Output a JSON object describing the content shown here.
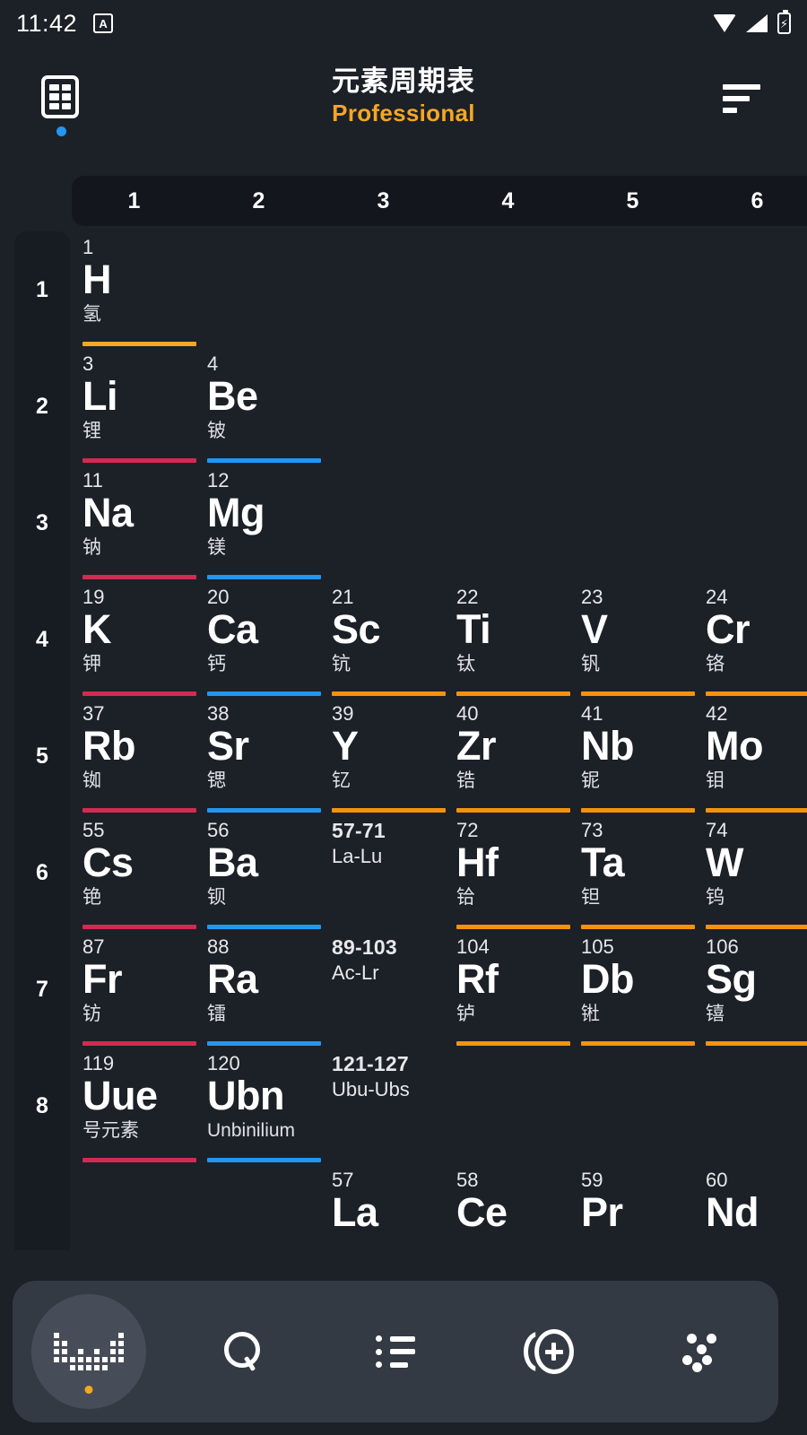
{
  "status_bar": {
    "time": "11:42",
    "badge_letter": "A",
    "icons": [
      "wifi-icon",
      "signal-icon",
      "battery-charging-icon"
    ]
  },
  "app_bar": {
    "logo_icon": "periodic-table-app-icon",
    "title": "元素周期表",
    "subtitle": "Professional",
    "menu_icon": "sort-filter-icon"
  },
  "table": {
    "group_headers": [
      "1",
      "2",
      "3",
      "4",
      "5",
      "6"
    ],
    "period_labels": [
      "1",
      "2",
      "3",
      "4",
      "5",
      "6",
      "7",
      "8"
    ],
    "colors": {
      "alkali_metal": "#d32a52",
      "alkaline_earth": "#2196f3",
      "transition_metal": "#f5920b",
      "nonmetal": "#f5a623",
      "background": "#1c2027",
      "sidebar": "#171b22",
      "header_strip": "#13171d"
    },
    "cells": [
      {
        "num": "1",
        "sym": "H",
        "name": "氢",
        "col": 1,
        "row": 1,
        "color": "#f5a623",
        "radioactive": false
      },
      {
        "num": "3",
        "sym": "Li",
        "name": "锂",
        "col": 1,
        "row": 2,
        "color": "#d32a52",
        "radioactive": false
      },
      {
        "num": "4",
        "sym": "Be",
        "name": "铍",
        "col": 2,
        "row": 2,
        "color": "#2196f3",
        "radioactive": false
      },
      {
        "num": "11",
        "sym": "Na",
        "name": "钠",
        "col": 1,
        "row": 3,
        "color": "#d32a52",
        "radioactive": false
      },
      {
        "num": "12",
        "sym": "Mg",
        "name": "镁",
        "col": 2,
        "row": 3,
        "color": "#2196f3",
        "radioactive": false
      },
      {
        "num": "19",
        "sym": "K",
        "name": "钾",
        "col": 1,
        "row": 4,
        "color": "#d32a52",
        "radioactive": false
      },
      {
        "num": "20",
        "sym": "Ca",
        "name": "钙",
        "col": 2,
        "row": 4,
        "color": "#2196f3",
        "radioactive": false
      },
      {
        "num": "21",
        "sym": "Sc",
        "name": "钪",
        "col": 3,
        "row": 4,
        "color": "#f5920b",
        "radioactive": false
      },
      {
        "num": "22",
        "sym": "Ti",
        "name": "钛",
        "col": 4,
        "row": 4,
        "color": "#f5920b",
        "radioactive": false
      },
      {
        "num": "23",
        "sym": "V",
        "name": "钒",
        "col": 5,
        "row": 4,
        "color": "#f5920b",
        "radioactive": false
      },
      {
        "num": "24",
        "sym": "Cr",
        "name": "铬",
        "col": 6,
        "row": 4,
        "color": "#f5920b",
        "radioactive": false
      },
      {
        "num": "37",
        "sym": "Rb",
        "name": "铷",
        "col": 1,
        "row": 5,
        "color": "#d32a52",
        "radioactive": false
      },
      {
        "num": "38",
        "sym": "Sr",
        "name": "锶",
        "col": 2,
        "row": 5,
        "color": "#2196f3",
        "radioactive": false
      },
      {
        "num": "39",
        "sym": "Y",
        "name": "钇",
        "col": 3,
        "row": 5,
        "color": "#f5920b",
        "radioactive": false
      },
      {
        "num": "40",
        "sym": "Zr",
        "name": "锆",
        "col": 4,
        "row": 5,
        "color": "#f5920b",
        "radioactive": false
      },
      {
        "num": "41",
        "sym": "Nb",
        "name": "铌",
        "col": 5,
        "row": 5,
        "color": "#f5920b",
        "radioactive": false
      },
      {
        "num": "42",
        "sym": "Mo",
        "name": "钼",
        "col": 6,
        "row": 5,
        "color": "#f5920b",
        "radioactive": false
      },
      {
        "num": "55",
        "sym": "Cs",
        "name": "铯",
        "col": 1,
        "row": 6,
        "color": "#d32a52",
        "radioactive": false
      },
      {
        "num": "56",
        "sym": "Ba",
        "name": "钡",
        "col": 2,
        "row": 6,
        "color": "#2196f3",
        "radioactive": false
      },
      {
        "num": "57-71",
        "sym": "",
        "name": "",
        "sub": "La-Lu",
        "col": 3,
        "row": 6,
        "color": "",
        "radioactive": false,
        "is_range": true
      },
      {
        "num": "72",
        "sym": "Hf",
        "name": "铪",
        "col": 4,
        "row": 6,
        "color": "#f5920b",
        "radioactive": false
      },
      {
        "num": "73",
        "sym": "Ta",
        "name": "钽",
        "col": 5,
        "row": 6,
        "color": "#f5920b",
        "radioactive": false
      },
      {
        "num": "74",
        "sym": "W",
        "name": "钨",
        "col": 6,
        "row": 6,
        "color": "#f5920b",
        "radioactive": false
      },
      {
        "num": "87",
        "sym": "Fr",
        "name": "钫",
        "col": 1,
        "row": 7,
        "color": "#d32a52",
        "radioactive": true
      },
      {
        "num": "88",
        "sym": "Ra",
        "name": "镭",
        "col": 2,
        "row": 7,
        "color": "#2196f3",
        "radioactive": true
      },
      {
        "num": "89-103",
        "sym": "",
        "name": "",
        "sub": "Ac-Lr",
        "col": 3,
        "row": 7,
        "color": "",
        "radioactive": false,
        "is_range": true
      },
      {
        "num": "104",
        "sym": "Rf",
        "name": "𬬻",
        "col": 4,
        "row": 7,
        "color": "#f5920b",
        "radioactive": true
      },
      {
        "num": "105",
        "sym": "Db",
        "name": "𬭊",
        "col": 5,
        "row": 7,
        "color": "#f5920b",
        "radioactive": true
      },
      {
        "num": "106",
        "sym": "Sg",
        "name": "𬭳",
        "col": 6,
        "row": 7,
        "color": "#f5920b",
        "radioactive": false
      },
      {
        "num": "119",
        "sym": "Uue",
        "name": "号元素",
        "col": 1,
        "row": 8,
        "color": "#d32a52",
        "radioactive": false
      },
      {
        "num": "120",
        "sym": "Ubn",
        "name": "Unbinilium",
        "col": 2,
        "row": 8,
        "color": "#2196f3",
        "radioactive": false
      },
      {
        "num": "121-127",
        "sym": "",
        "name": "",
        "sub": "Ubu-Ubs",
        "col": 3,
        "row": 8,
        "color": "",
        "radioactive": false,
        "is_range": true
      },
      {
        "num": "57",
        "sym": "La",
        "name": "",
        "col": 3,
        "row": 9,
        "color": "",
        "radioactive": false
      },
      {
        "num": "58",
        "sym": "Ce",
        "name": "",
        "col": 4,
        "row": 9,
        "color": "",
        "radioactive": false
      },
      {
        "num": "59",
        "sym": "Pr",
        "name": "",
        "col": 5,
        "row": 9,
        "color": "",
        "radioactive": false
      },
      {
        "num": "60",
        "sym": "Nd",
        "name": "",
        "col": 6,
        "row": 9,
        "color": "",
        "radioactive": false
      }
    ]
  },
  "bottom_nav": {
    "items": [
      {
        "icon": "periodic-table-icon",
        "active": true
      },
      {
        "icon": "search-icon",
        "active": false
      },
      {
        "icon": "list-icon",
        "active": false
      },
      {
        "icon": "isotopes-icon",
        "active": false
      },
      {
        "icon": "molecules-icon",
        "active": false
      }
    ]
  }
}
